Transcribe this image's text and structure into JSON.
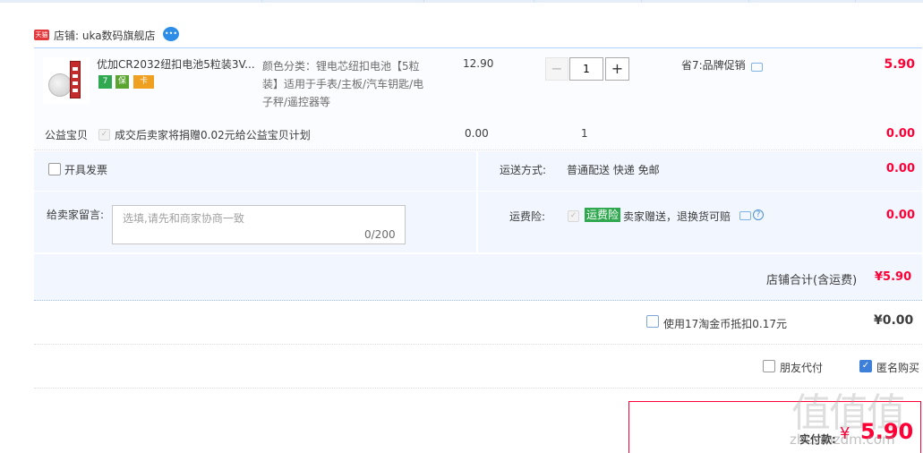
{
  "shop": {
    "badge": "天猫",
    "label": "店铺: uka数码旗舰店",
    "wangwang_icon": "wangwang-chat-icon"
  },
  "item": {
    "title": "优加CR2032纽扣电池5粒装3V...",
    "sku_text": "颜色分类：锂电芯纽扣电池【5粒装】适用于手表/主板/汽车钥匙/电子秤/遥控器等",
    "price": "12.90",
    "quantity": "1",
    "qty_minus": "−",
    "qty_plus": "+",
    "promo": "省7:品牌促销",
    "total": "5.90",
    "service_badges": [
      "7",
      "保",
      "卡"
    ]
  },
  "charity": {
    "label": "公益宝贝",
    "text": "成交后卖家将捐赠0.02元给公益宝贝计划",
    "price": "0.00",
    "qty": "1",
    "total": "0.00"
  },
  "invoice": {
    "label": "开具发票",
    "checked": false
  },
  "message": {
    "label": "给卖家留言:",
    "placeholder": "选填,请先和商家协商一致",
    "counter": "0/200"
  },
  "shipping": {
    "label": "运送方式:",
    "value": "普通配送 快递 免邮",
    "amount": "0.00"
  },
  "insurance": {
    "label": "运费险:",
    "badge": "运费险",
    "text": "卖家赠送，退换货可赔",
    "amount": "0.00"
  },
  "shop_total": {
    "label": "店铺合计(含运费)",
    "value": "¥5.90"
  },
  "coins": {
    "text": "使用17淘金币抵扣0.17元",
    "amount": "¥0.00",
    "checked": false
  },
  "options": {
    "friend_pay": "朋友代付",
    "anonymous": "匿名购买",
    "anonymous_checked": true
  },
  "payable": {
    "label": "实付款:",
    "currency": "¥",
    "value": "5.90"
  },
  "watermark": {
    "text": "值值值",
    "url": "zhi.smzdm.com"
  },
  "colors": {
    "accent_red": "#ff0036",
    "panel_blue": "#f2f7ff",
    "border_blue": "#b2d1ff",
    "badge_green": "#2fa84f"
  }
}
